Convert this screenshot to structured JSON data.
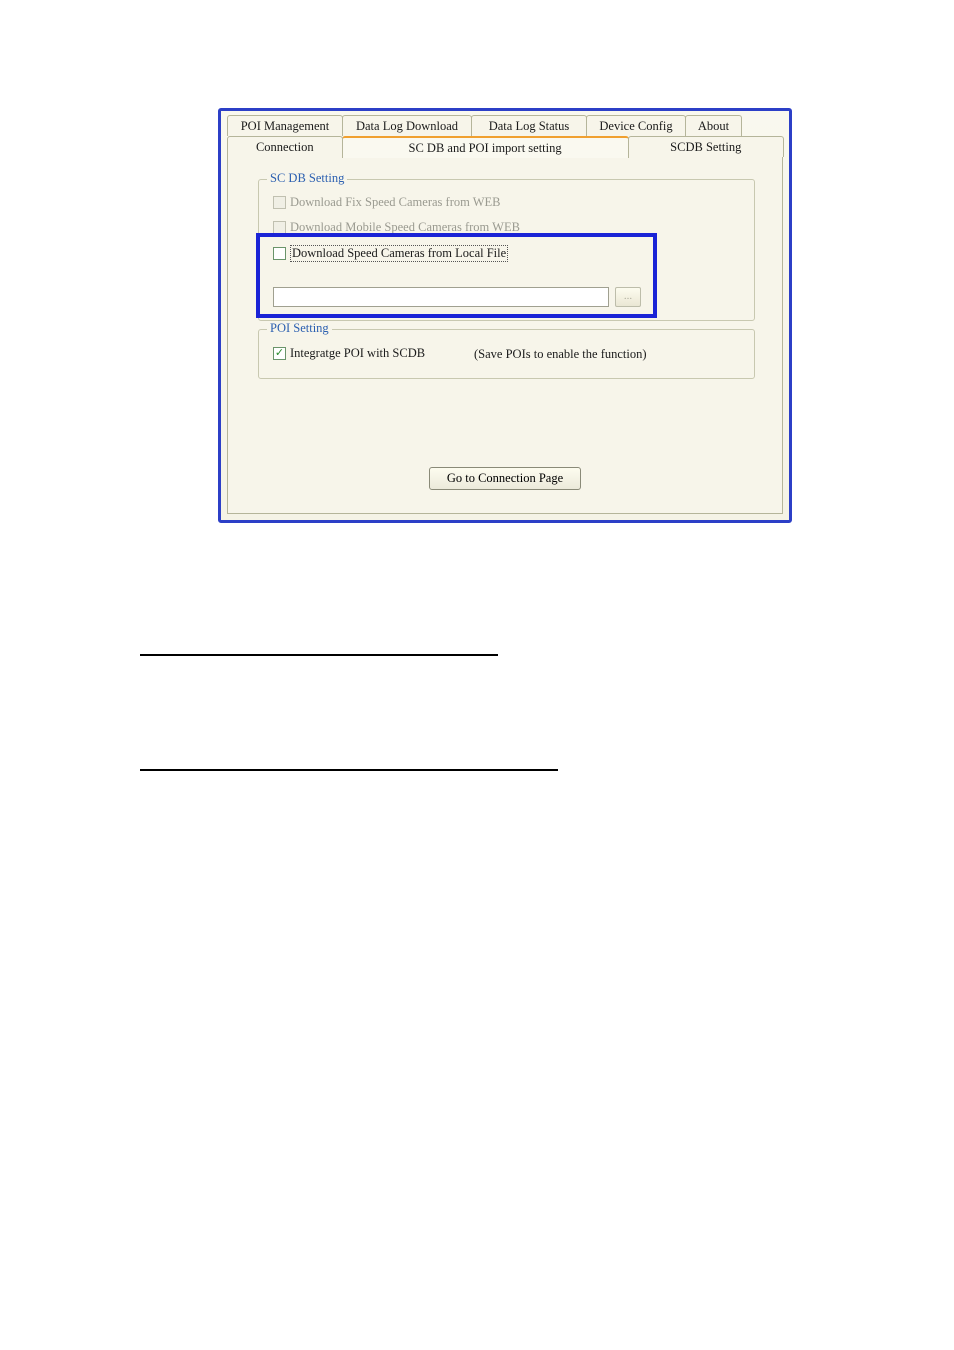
{
  "tabs_row1": {
    "poi_management": "POI Management",
    "data_log_download": "Data Log Download",
    "data_log_status": "Data Log Status",
    "device_config": "Device Config",
    "about": "About"
  },
  "tabs_row2": {
    "connection": "Connection",
    "scdb_poi_import": "SC DB and POI import setting",
    "scdb_setting": "SCDB  Setting"
  },
  "scdb_group": {
    "legend": "SC DB  Setting",
    "opt_fix_web": "Download Fix Speed Cameras from WEB",
    "opt_mobile_web": "Download Mobile Speed Cameras from WEB",
    "opt_local_file": "Download  Speed Cameras from Local File",
    "browse_label": "..."
  },
  "poi_group": {
    "legend": "POI Setting",
    "integrate_label": "Integratge  POI with  SCDB",
    "hint": "(Save POIs to enable the function)"
  },
  "connection_button": "Go to Connection Page"
}
